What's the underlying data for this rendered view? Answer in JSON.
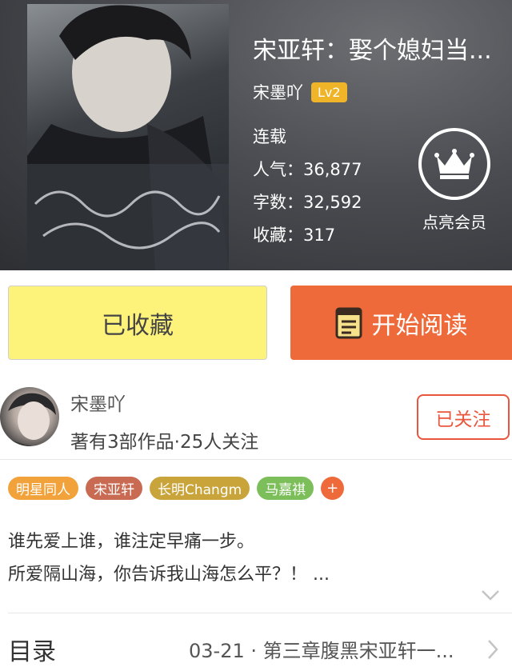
{
  "book": {
    "title": "宋亚轩：娶个媳妇当...",
    "author": "宋墨吖",
    "level": "Lv2",
    "status": "连载",
    "popularity": "人气：36,877",
    "word_count": "字数：32,592",
    "favorites": "收藏：317"
  },
  "membership": {
    "label": "点亮会员",
    "icon": "crown-icon"
  },
  "actions": {
    "favorite_label": "已收藏",
    "read_label": "开始阅读",
    "read_icon": "book-icon"
  },
  "author": {
    "name": "宋墨吖",
    "stats": "著有3部作品·25人关注",
    "follow_label": "已关注"
  },
  "tags": [
    {
      "label": "明星同人",
      "color": "#f2a23a"
    },
    {
      "label": "宋亚轩",
      "color": "#c96a52"
    },
    {
      "label": "长明Changm",
      "color": "#c9a43a"
    },
    {
      "label": "马嘉祺",
      "color": "#7cbf5a"
    }
  ],
  "tag_add_label": "+",
  "description": {
    "line1": "谁先爱上谁，谁注定早痛一步。",
    "line2": "所爱隔山海，你告诉我山海怎么平？！ ..."
  },
  "toc": {
    "label": "目录",
    "latest": "03-21 · 第三章腹黑宋亚轩一..."
  }
}
